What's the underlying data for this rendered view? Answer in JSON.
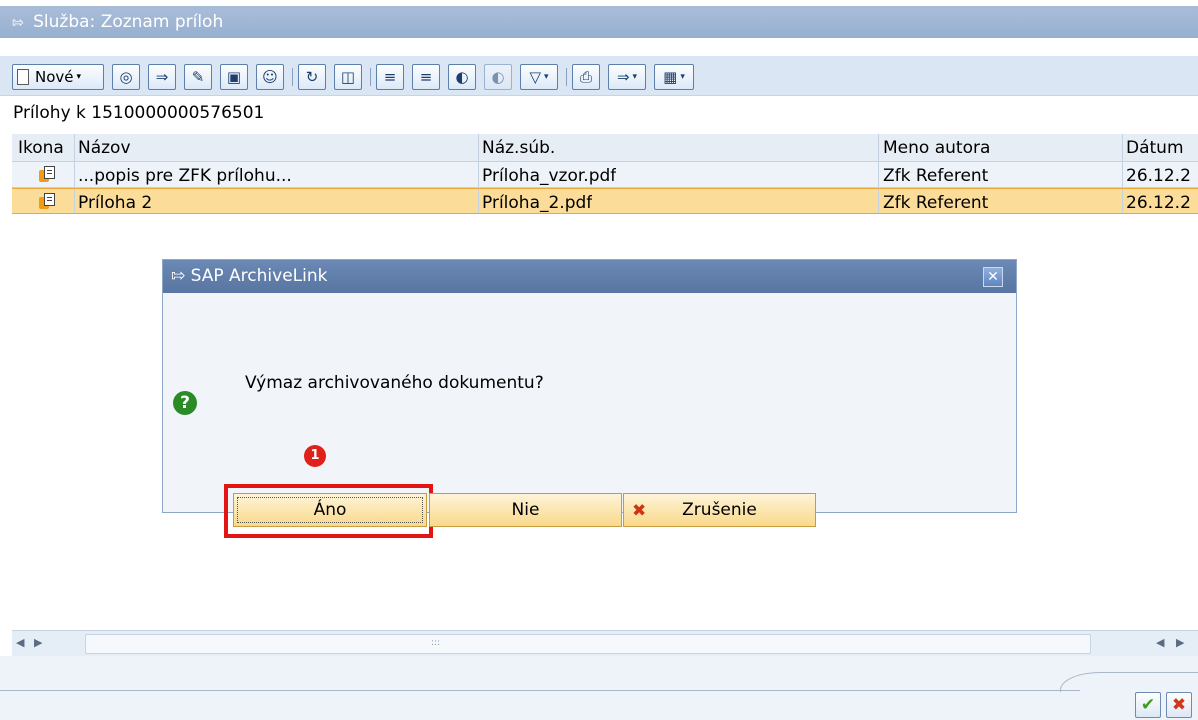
{
  "window": {
    "title": "Služba: Zoznam príloh"
  },
  "toolbar": {
    "new_label": "Nové"
  },
  "heading": "Prílohy k 1510000000576501",
  "table": {
    "columns": [
      "Ikona",
      "Názov",
      "Náz.súb.",
      "Meno autora",
      "Dátum"
    ],
    "rows": [
      {
        "name": "...popis pre ZFK prílohu...",
        "file": "Príloha_vzor.pdf",
        "author": "Zfk Referent",
        "date": "26.12.2"
      },
      {
        "name": "Príloha 2",
        "file": "Príloha_2.pdf",
        "author": "Zfk Referent",
        "date": "26.12.2"
      }
    ]
  },
  "dialog": {
    "title": "SAP ArchiveLink",
    "question": "Výmaz archivovaného dokumentu?",
    "yes_label": "Áno",
    "no_label": "Nie",
    "cancel_label": "Zrušenie"
  },
  "annotation": {
    "badge": "1"
  },
  "colors": {
    "selected_row": "#fbdc99",
    "highlight": "#e31414",
    "dialog_title": "#5875a3"
  }
}
